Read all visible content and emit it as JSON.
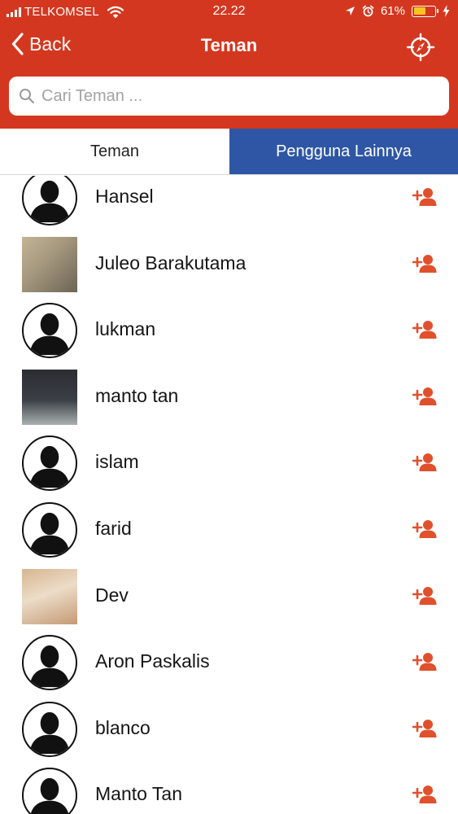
{
  "status_bar": {
    "carrier": "TELKOMSEL",
    "time": "22.22",
    "battery_text": "61%",
    "battery_level": 0.61,
    "icons": [
      "signal-icon",
      "wifi-icon",
      "location-icon",
      "alarm-icon",
      "battery-icon",
      "charging-icon"
    ]
  },
  "navbar": {
    "back_label": "Back",
    "title": "Teman",
    "right_icon": "compass-icon"
  },
  "search": {
    "placeholder": "Cari Teman ...",
    "value": ""
  },
  "tabs": [
    {
      "label": "Teman",
      "active": false
    },
    {
      "label": "Pengguna Lainnya",
      "active": true
    }
  ],
  "users": [
    {
      "name": "Hansel",
      "avatar": "default"
    },
    {
      "name": "Juleo Barakutama",
      "avatar": "photo"
    },
    {
      "name": "lukman",
      "avatar": "default"
    },
    {
      "name": "manto tan",
      "avatar": "photo"
    },
    {
      "name": "islam",
      "avatar": "default"
    },
    {
      "name": "farid",
      "avatar": "default"
    },
    {
      "name": "Dev",
      "avatar": "photo"
    },
    {
      "name": "Aron Paskalis",
      "avatar": "default"
    },
    {
      "name": "blanco",
      "avatar": "default"
    },
    {
      "name": "Manto Tan",
      "avatar": "default"
    }
  ],
  "colors": {
    "header_red": "#d4371f",
    "tab_active_blue": "#2e56a5",
    "add_icon_orange": "#e0502c",
    "battery_yellow": "#f5c623"
  }
}
